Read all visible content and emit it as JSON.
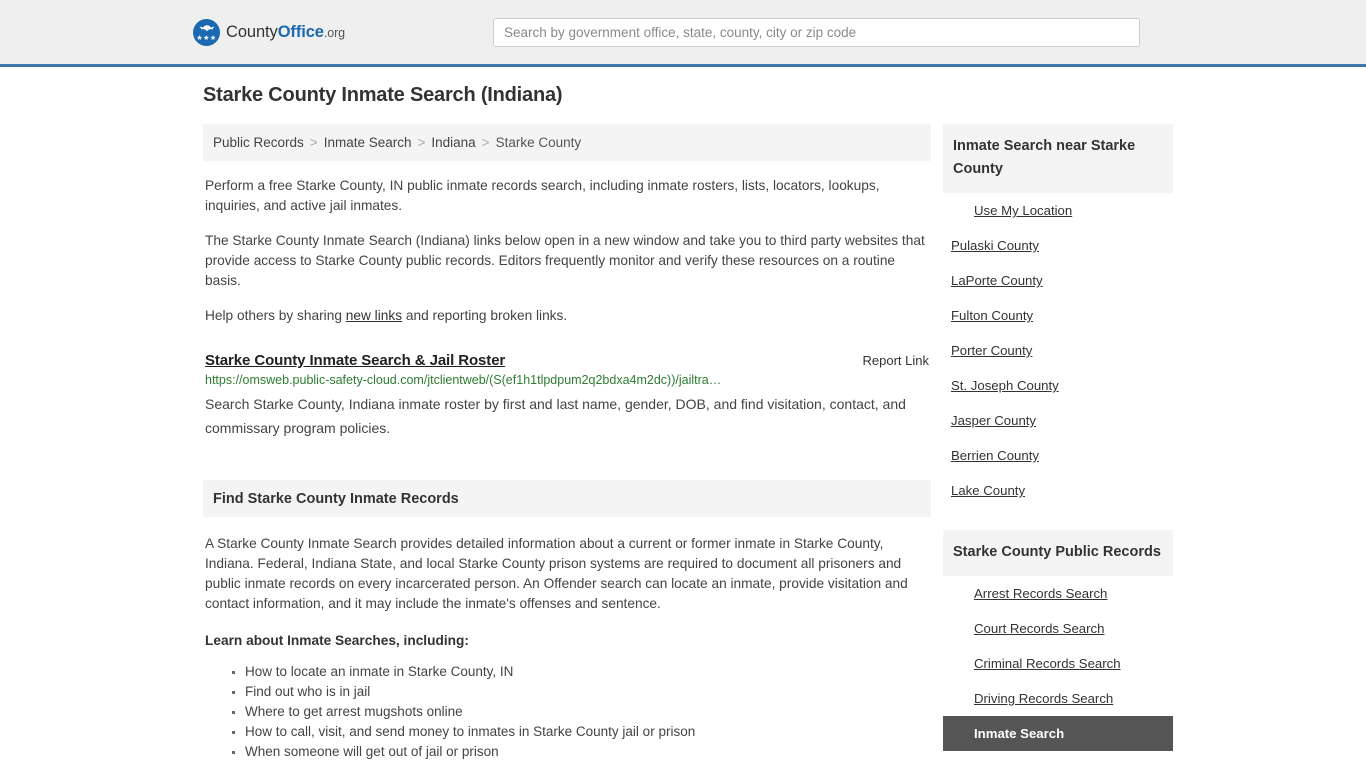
{
  "header": {
    "logo_name": "CountyOffice.org",
    "logo_part1": "County",
    "logo_part2": "Office",
    "logo_tld": ".org",
    "logo_stars": "★★★",
    "search_placeholder": "Search by government office, state, county, city or zip code",
    "search_value": "",
    "accent_color": "#3c78ab"
  },
  "page": {
    "title": "Starke County Inmate Search (Indiana)"
  },
  "breadcrumb": {
    "items": [
      {
        "label": "Public Records"
      },
      {
        "label": "Inmate Search"
      },
      {
        "label": "Indiana"
      },
      {
        "label": "Starke County"
      }
    ],
    "separator": ">"
  },
  "intro": {
    "paragraph1": "Perform a free Starke County, IN public inmate records search, including inmate rosters, lists, locators, lookups, inquiries, and active jail inmates.",
    "paragraph2": "The Starke County Inmate Search (Indiana) links below open in a new window and take you to third party websites that provide access to Starke County public records. Editors frequently monitor and verify these resources on a routine basis.",
    "paragraph3_before": "Help others by sharing ",
    "paragraph3_link": "new links",
    "paragraph3_after": " and reporting broken links."
  },
  "result": {
    "title": "Starke County Inmate Search & Jail Roster",
    "report_label": "Report Link",
    "url": "https://omsweb.public-safety-cloud.com/jtclientweb/(S(ef1h1tlpdpum2q2bdxa4m2dc))/jailtra…",
    "description": "Search Starke County, Indiana inmate roster by first and last name, gender, DOB, and find visitation, contact, and commissary program policies.",
    "url_color": "#2e7d32"
  },
  "find_section": {
    "heading": "Find Starke County Inmate Records",
    "paragraph": "A Starke County Inmate Search provides detailed information about a current or former inmate in Starke County, Indiana. Federal, Indiana State, and local Starke County prison systems are required to document all prisoners and public inmate records on every incarcerated person. An Offender search can locate an inmate, provide visitation and contact information, and it may include the inmate's offenses and sentence.",
    "lead_in": "Learn about Inmate Searches, including:",
    "bullets": [
      "How to locate an inmate in Starke County, IN",
      "Find out who is in jail",
      "Where to get arrest mugshots online",
      "How to call, visit, and send money to inmates in Starke County jail or prison",
      "When someone will get out of jail or prison"
    ]
  },
  "sidebar": {
    "nearby": {
      "heading": "Inmate Search near Starke County",
      "items": [
        {
          "label": "Use My Location",
          "indented": true,
          "active": false
        },
        {
          "label": "Pulaski County",
          "indented": false,
          "active": false
        },
        {
          "label": "LaPorte County",
          "indented": false,
          "active": false
        },
        {
          "label": "Fulton County",
          "indented": false,
          "active": false
        },
        {
          "label": "Porter County",
          "indented": false,
          "active": false
        },
        {
          "label": "St. Joseph County",
          "indented": false,
          "active": false
        },
        {
          "label": "Jasper County",
          "indented": false,
          "active": false
        },
        {
          "label": "Berrien County",
          "indented": false,
          "active": false
        },
        {
          "label": "Lake County",
          "indented": false,
          "active": false
        }
      ]
    },
    "public_records": {
      "heading": "Starke County Public Records",
      "active_color": "#555555",
      "items": [
        {
          "label": "Arrest Records Search",
          "indented": true,
          "active": false
        },
        {
          "label": "Court Records Search",
          "indented": true,
          "active": false
        },
        {
          "label": "Criminal Records Search",
          "indented": true,
          "active": false
        },
        {
          "label": "Driving Records Search",
          "indented": true,
          "active": false
        },
        {
          "label": "Inmate Search",
          "indented": true,
          "active": true
        }
      ]
    }
  }
}
